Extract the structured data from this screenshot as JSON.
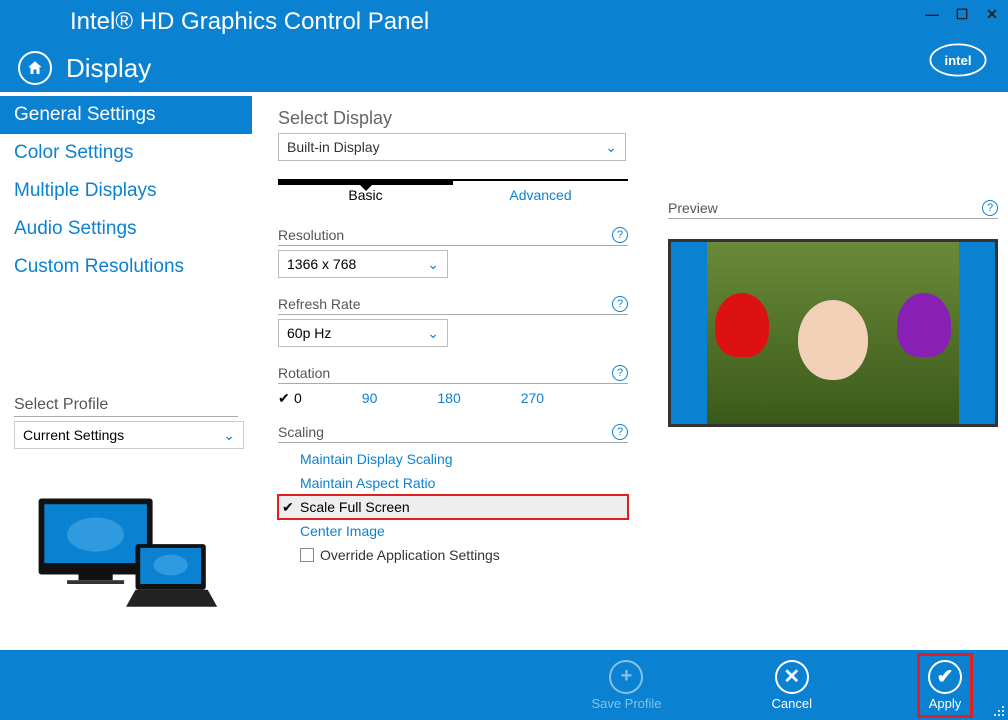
{
  "window": {
    "title": "Intel® HD Graphics Control Panel",
    "section": "Display"
  },
  "sidebar": {
    "items": [
      {
        "label": "General Settings",
        "active": true
      },
      {
        "label": "Color Settings"
      },
      {
        "label": "Multiple Displays"
      },
      {
        "label": "Audio Settings"
      },
      {
        "label": "Custom Resolutions"
      }
    ],
    "profile_label": "Select Profile",
    "profile_value": "Current Settings"
  },
  "content": {
    "select_display_label": "Select Display",
    "select_display_value": "Built-in Display",
    "tabs": {
      "basic": "Basic",
      "advanced": "Advanced"
    },
    "resolution": {
      "label": "Resolution",
      "value": "1366 x 768"
    },
    "refresh": {
      "label": "Refresh Rate",
      "value": "60p Hz"
    },
    "rotation": {
      "label": "Rotation",
      "options": [
        "0",
        "90",
        "180",
        "270"
      ],
      "selected": "0"
    },
    "scaling": {
      "label": "Scaling",
      "options": [
        "Maintain Display Scaling",
        "Maintain Aspect Ratio",
        "Scale Full Screen",
        "Center Image"
      ],
      "selected": "Scale Full Screen",
      "override_label": "Override Application Settings",
      "override_checked": false
    },
    "preview_label": "Preview"
  },
  "footer": {
    "save": "Save Profile",
    "cancel": "Cancel",
    "apply": "Apply"
  }
}
